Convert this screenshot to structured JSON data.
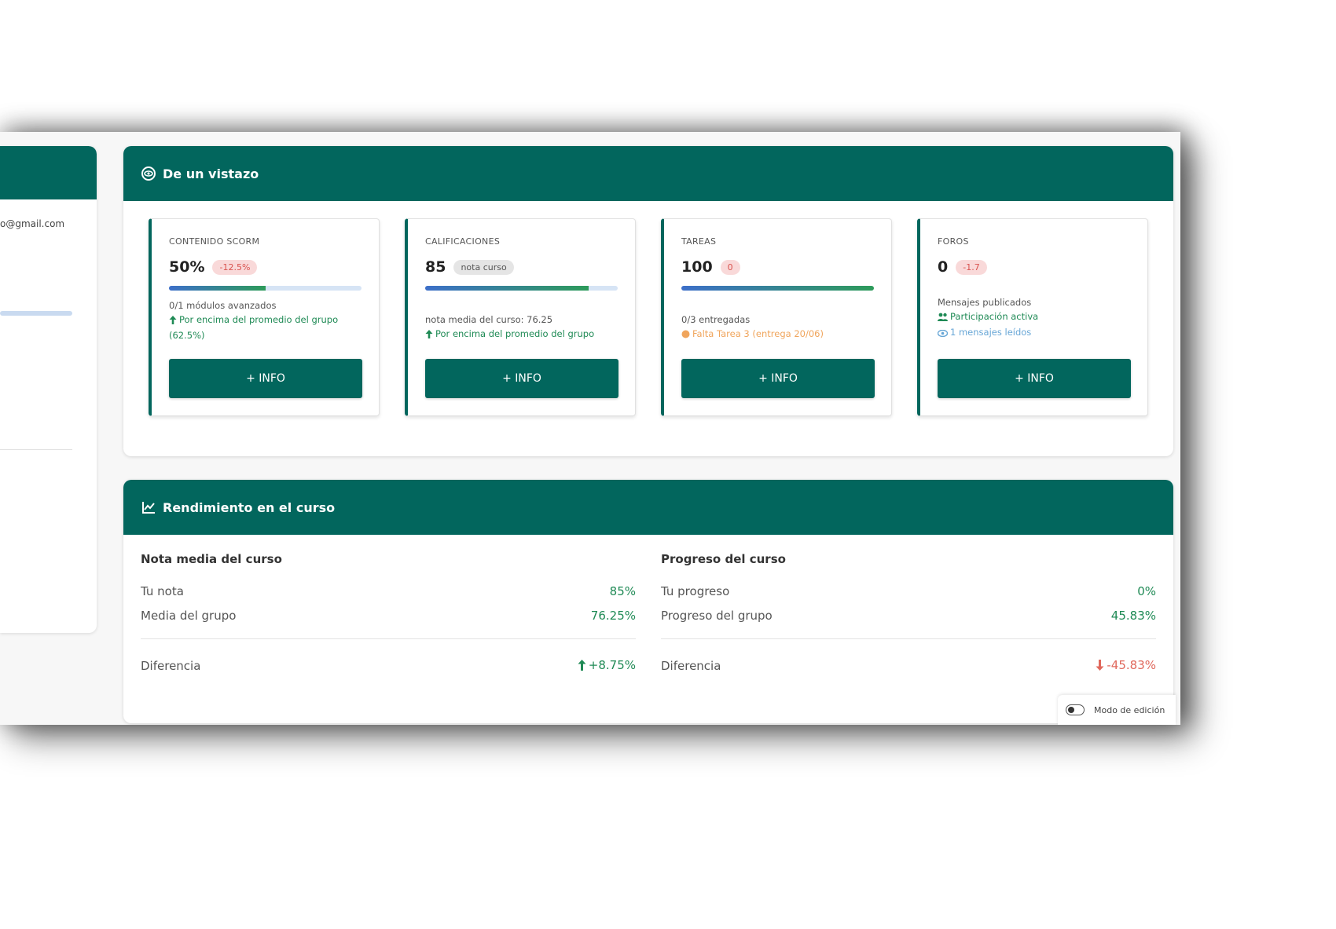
{
  "profile": {
    "email_fragment": "o@gmail.com"
  },
  "overview": {
    "title": "De un vistazo",
    "info_label": "+ INFO",
    "cards": [
      {
        "label": "CONTENIDO SCORM",
        "value": "50%",
        "badge": "-12.5%",
        "progress": 0.5,
        "line1": "0/1 módulos avanzados",
        "line2": "Por encima del promedio del grupo (62.5%)"
      },
      {
        "label": "CALIFICACIONES",
        "value": "85",
        "badge": "nota curso",
        "progress": 0.85,
        "line1": "nota media del curso: 76.25",
        "line2": "Por encima del promedio del grupo"
      },
      {
        "label": "TAREAS",
        "value": "100",
        "badge": "0",
        "progress": 1.0,
        "line1": "0/3 entregadas",
        "line2": "Falta Tarea 3 (entrega 20/06)"
      },
      {
        "label": "FOROS",
        "value": "0",
        "badge": "-1.7",
        "line1": "Mensajes publicados",
        "line2": "Participación activa",
        "line3": "1 mensajes leídos"
      }
    ]
  },
  "performance": {
    "title": "Rendimiento en el curso",
    "grade": {
      "title": "Nota media del curso",
      "rows": [
        {
          "label": "Tu nota",
          "value": "85%"
        },
        {
          "label": "Media del grupo",
          "value": "76.25%"
        }
      ],
      "diff_label": "Diferencia",
      "diff_value": "+8.75%"
    },
    "progress": {
      "title": "Progreso del curso",
      "rows": [
        {
          "label": "Tu progreso",
          "value": "0%"
        },
        {
          "label": "Progreso del grupo",
          "value": "45.83%"
        }
      ],
      "diff_label": "Diferencia",
      "diff_value": "-45.83%"
    }
  },
  "edit_mode": {
    "label": "Modo de edición"
  },
  "colors": {
    "primary": "#02665d",
    "positive": "#1f8a55",
    "negative": "#e0685c",
    "warning": "#f0a55c"
  }
}
